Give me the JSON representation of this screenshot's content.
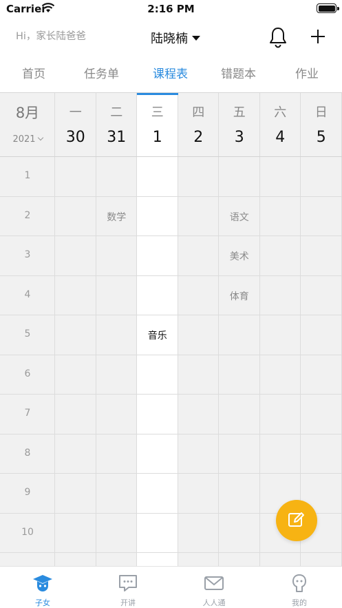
{
  "status_bar": {
    "carrier": "Carrier",
    "time": "2:16 PM"
  },
  "header": {
    "greeting": "Hi，家长陆爸爸",
    "child_name": "陆晓楠"
  },
  "tabs": [
    {
      "label": "首页",
      "active": false
    },
    {
      "label": "任务单",
      "active": false
    },
    {
      "label": "课程表",
      "active": true
    },
    {
      "label": "错题本",
      "active": false
    },
    {
      "label": "作业",
      "active": false
    }
  ],
  "calendar": {
    "month": "8月",
    "year": "2021",
    "days": [
      {
        "weekday": "一",
        "date": "30",
        "today": false
      },
      {
        "weekday": "二",
        "date": "31",
        "today": false
      },
      {
        "weekday": "三",
        "date": "1",
        "today": true
      },
      {
        "weekday": "四",
        "date": "2",
        "today": false
      },
      {
        "weekday": "五",
        "date": "3",
        "today": false
      },
      {
        "weekday": "六",
        "date": "4",
        "today": false
      },
      {
        "weekday": "日",
        "date": "5",
        "today": false
      }
    ],
    "periods": [
      "1",
      "2",
      "3",
      "4",
      "5",
      "6",
      "7",
      "8",
      "9",
      "10"
    ],
    "courses": [
      {
        "period": 2,
        "day": 2,
        "name": "数学"
      },
      {
        "period": 2,
        "day": 5,
        "name": "语文"
      },
      {
        "period": 3,
        "day": 5,
        "name": "美术"
      },
      {
        "period": 4,
        "day": 5,
        "name": "体育"
      },
      {
        "period": 5,
        "day": 3,
        "name": "音乐"
      }
    ]
  },
  "bottom_nav": [
    {
      "label": "子女",
      "icon": "graduate-icon",
      "active": true
    },
    {
      "label": "开讲",
      "icon": "chat-bubble-icon",
      "active": false
    },
    {
      "label": "人人通",
      "icon": "mail-icon",
      "active": false
    },
    {
      "label": "我的",
      "icon": "profile-icon",
      "active": false
    }
  ],
  "colors": {
    "accent": "#2a8bdf",
    "fab": "#f7b313",
    "grid_bg": "#f1f1f1"
  }
}
